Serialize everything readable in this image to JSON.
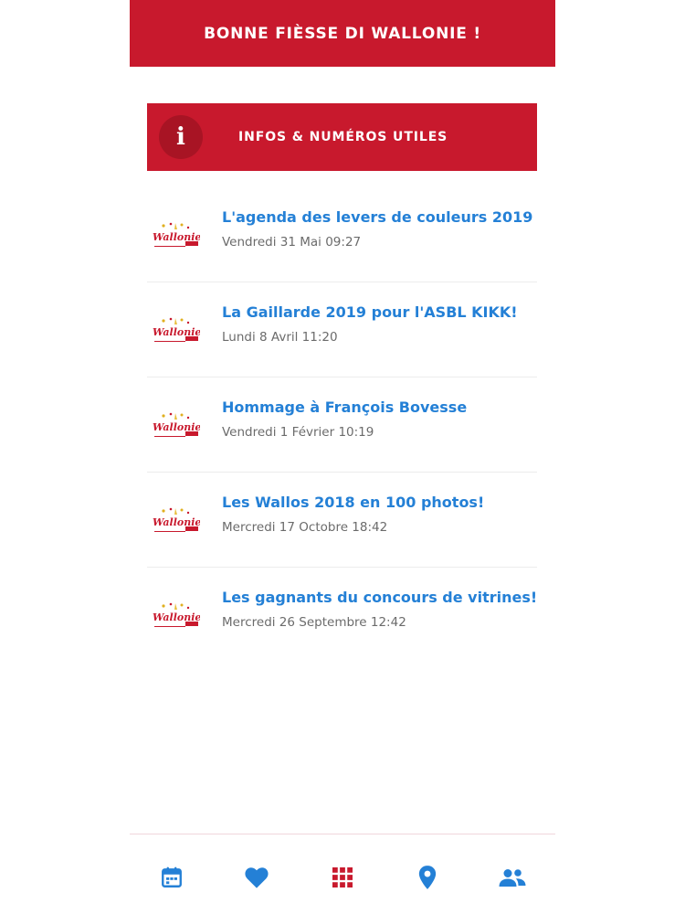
{
  "header": {
    "title": "BONNE FIÈSSE DI WALLONIE !"
  },
  "info_banner": {
    "icon_glyph": "i",
    "label": "INFOS & NUMÉROS UTILES"
  },
  "news": [
    {
      "title": "L'agenda des levers de couleurs 2019",
      "date": "Vendredi 31 Mai 09:27",
      "thumb_text": "Wallonie"
    },
    {
      "title": "La Gaillarde 2019 pour l'ASBL KIKK!",
      "date": "Lundi 8 Avril 11:20",
      "thumb_text": "Wallonie"
    },
    {
      "title": "Hommage à François Bovesse",
      "date": "Vendredi 1 Février 10:19",
      "thumb_text": "Wallonie"
    },
    {
      "title": "Les Wallos 2018 en 100 photos!",
      "date": "Mercredi 17 Octobre 18:42",
      "thumb_text": "Wallonie"
    },
    {
      "title": "Les gagnants du concours de vitrines!",
      "date": "Mercredi 26 Septembre 12:42",
      "thumb_text": "Wallonie"
    }
  ],
  "tabs": [
    {
      "icon": "calendar-icon",
      "color": "#2480d6"
    },
    {
      "icon": "heart-icon",
      "color": "#2480d6"
    },
    {
      "icon": "grid-icon",
      "color": "#c8192d"
    },
    {
      "icon": "location-pin-icon",
      "color": "#2480d6"
    },
    {
      "icon": "people-icon",
      "color": "#2480d6"
    }
  ],
  "colors": {
    "brand_red": "#c8192d",
    "link_blue": "#2480d6",
    "date_gray": "#6b6b6b"
  }
}
